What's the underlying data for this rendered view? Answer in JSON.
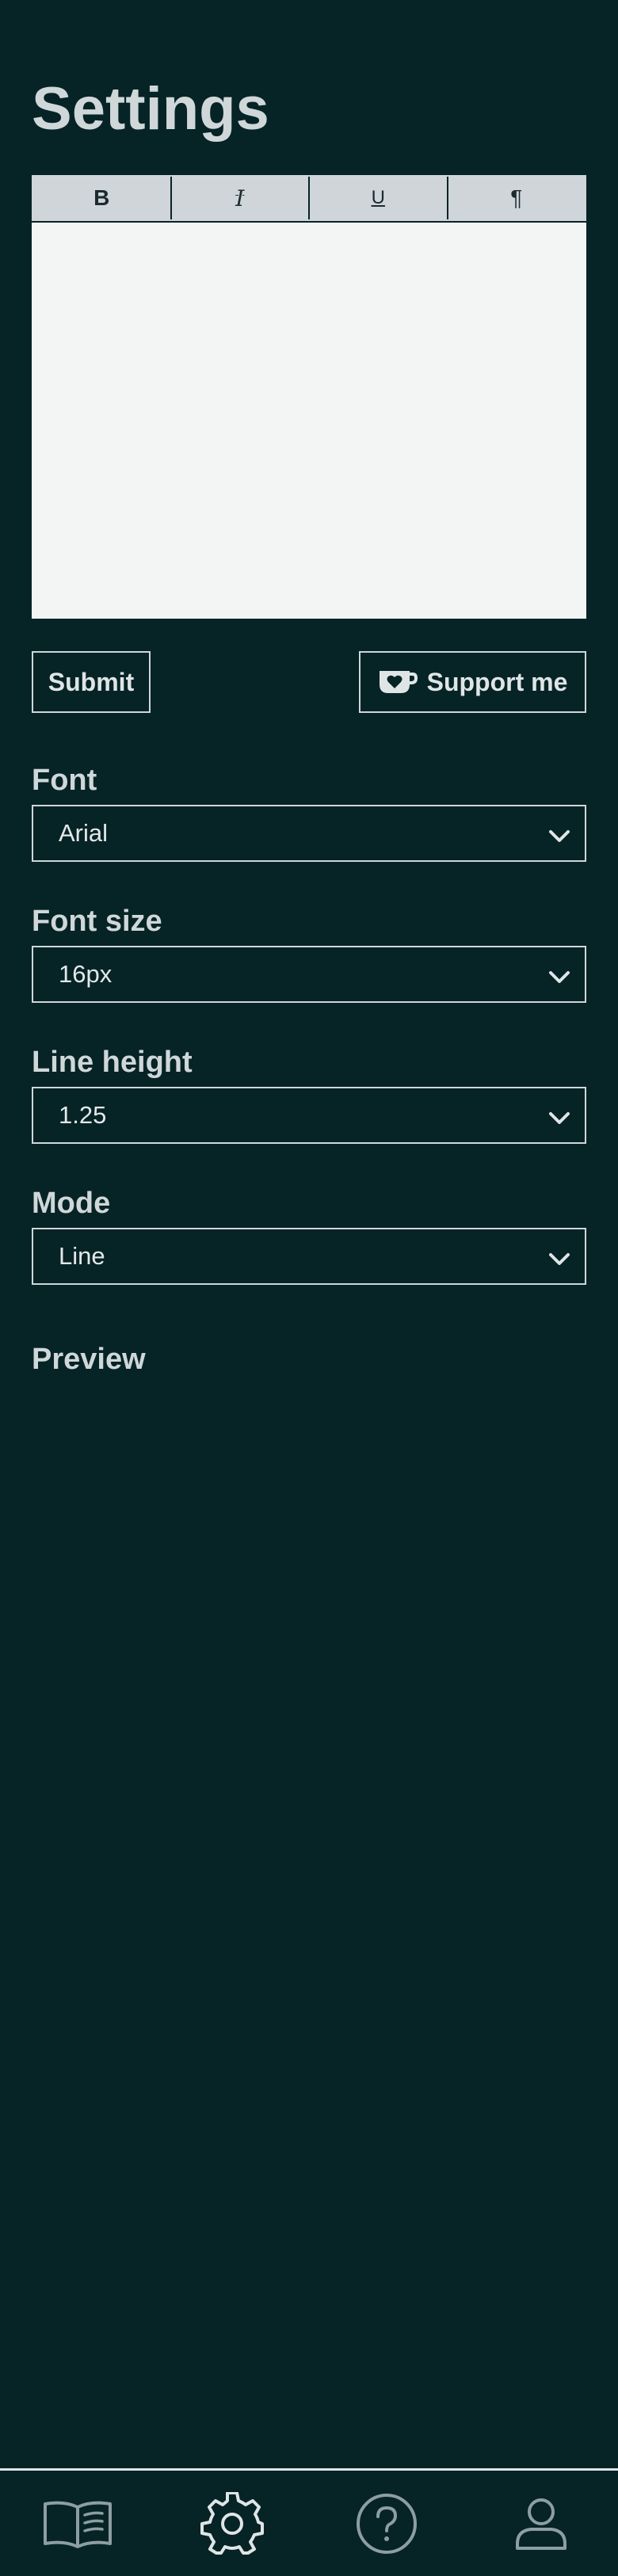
{
  "page": {
    "title": "Settings"
  },
  "toolbar": {
    "bold_label": "B",
    "italic_label": "I",
    "underline_label": "U",
    "paragraph_label": "¶"
  },
  "actions": {
    "submit_label": "Submit",
    "support_label": "Support me",
    "support_icon": "coffee-heart-icon"
  },
  "settings": {
    "font": {
      "label": "Font",
      "value": "Arial"
    },
    "font_size": {
      "label": "Font size",
      "value": "16px"
    },
    "line_height": {
      "label": "Line height",
      "value": "1.25"
    },
    "mode": {
      "label": "Mode",
      "value": "Line"
    }
  },
  "preview": {
    "title": "Preview"
  },
  "bottom_nav": {
    "items": [
      {
        "icon": "book-icon",
        "active": false
      },
      {
        "icon": "gear-icon",
        "active": true
      },
      {
        "icon": "help-icon",
        "active": false
      },
      {
        "icon": "user-icon",
        "active": false
      }
    ]
  },
  "colors": {
    "background": "#062326",
    "foreground": "#cfd7d9",
    "toolbar": "#cfd5d8",
    "editor": "#f3f5f5"
  }
}
